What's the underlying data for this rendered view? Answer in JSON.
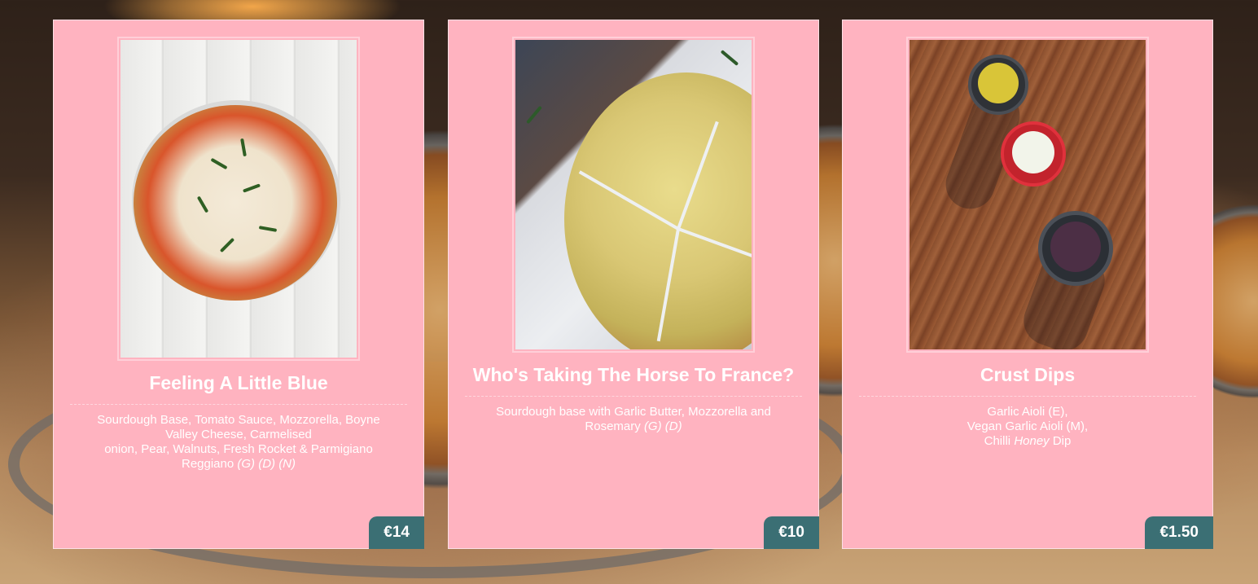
{
  "cards": [
    {
      "title": "Feeling A Little Blue",
      "desc_line1": "Sourdough Base, Tomato Sauce, Mozzorella, Boyne Valley Cheese, Carmelised",
      "desc_line2": "onion, Pear, Walnuts, Fresh Rocket & Parmigiano Reggiano",
      "desc_allergens": "(G) (D) (N)",
      "price": "€14",
      "image": "pizza-photo"
    },
    {
      "title": "Who's Taking The Horse To France?",
      "desc_line1": "Sourdough base with Garlic Butter, Mozzorella and Rosemary",
      "desc_allergens": "(G) (D)",
      "price": "€10",
      "image": "garlic-bread-photo"
    },
    {
      "title": "Crust Dips",
      "desc_line1": "Garlic Aioli (E),",
      "desc_line2": "Vegan Garlic Aioli (M),",
      "desc_line3_pre": "Chilli",
      "desc_line3_em": "Honey",
      "desc_line3_post": "Dip",
      "price": "€1.50",
      "image": "dips-photo"
    }
  ],
  "colors": {
    "card_background": "#ffb3c0",
    "price_badge": "#3b6f74",
    "text": "#ffffff"
  }
}
